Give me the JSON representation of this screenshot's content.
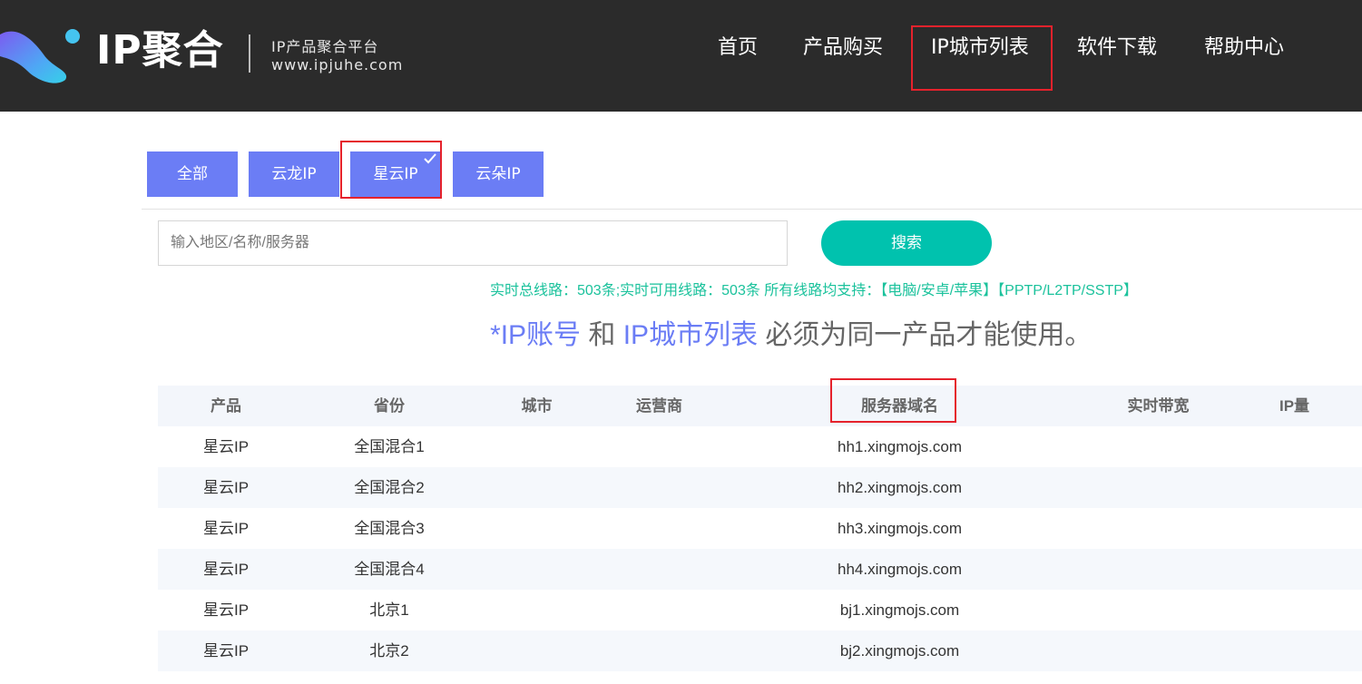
{
  "header": {
    "logo_text": "IP聚合",
    "logo_subtitle": "IP产品聚合平台",
    "logo_url": "www.ipjuhe.com",
    "nav": [
      {
        "label": "首页"
      },
      {
        "label": "产品购买"
      },
      {
        "label": "IP城市列表"
      },
      {
        "label": "软件下载"
      },
      {
        "label": "帮助中心"
      }
    ],
    "active_nav": "IP城市列表"
  },
  "filters": {
    "items": [
      {
        "label": "全部"
      },
      {
        "label": "云龙IP"
      },
      {
        "label": "星云IP"
      },
      {
        "label": "云朵IP"
      }
    ],
    "selected": "星云IP"
  },
  "search": {
    "value": "",
    "placeholder": "输入地区/名称/服务器",
    "button_label": "搜索"
  },
  "stats": {
    "text": "实时总线路：503条;实时可用线路：503条 所有线路均支持：【电脑/安卓/苹果】【PPTP/L2TP/SSTP】"
  },
  "notice": {
    "prefix": "*",
    "accent1": "IP账号",
    "mid": " 和 ",
    "accent2": "IP城市列表",
    "suffix": " 必须为同一产品才能使用。"
  },
  "table": {
    "headers": {
      "product": "产品",
      "province": "省份",
      "city": "城市",
      "isp": "运营商",
      "domain": "服务器域名",
      "bandwidth": "实时带宽",
      "ip_count": "IP量"
    },
    "rows": [
      {
        "product": "星云IP",
        "province": "全国混合1",
        "city": "",
        "isp": "",
        "domain": "hh1.xingmojs.com",
        "bandwidth": "",
        "ip_count": ""
      },
      {
        "product": "星云IP",
        "province": "全国混合2",
        "city": "",
        "isp": "",
        "domain": "hh2.xingmojs.com",
        "bandwidth": "",
        "ip_count": ""
      },
      {
        "product": "星云IP",
        "province": "全国混合3",
        "city": "",
        "isp": "",
        "domain": "hh3.xingmojs.com",
        "bandwidth": "",
        "ip_count": ""
      },
      {
        "product": "星云IP",
        "province": "全国混合4",
        "city": "",
        "isp": "",
        "domain": "hh4.xingmojs.com",
        "bandwidth": "",
        "ip_count": ""
      },
      {
        "product": "星云IP",
        "province": "北京1",
        "city": "",
        "isp": "",
        "domain": "bj1.xingmojs.com",
        "bandwidth": "",
        "ip_count": ""
      },
      {
        "product": "星云IP",
        "province": "北京2",
        "city": "",
        "isp": "",
        "domain": "bj2.xingmojs.com",
        "bandwidth": "",
        "ip_count": ""
      }
    ]
  },
  "colors": {
    "header_bg": "#2b2b2b",
    "filter_btn": "#6b7df5",
    "search_btn": "#00c2ae",
    "stats_text": "#1bc29c",
    "accent": "#6b7df5",
    "highlight_border": "#e5222c"
  }
}
